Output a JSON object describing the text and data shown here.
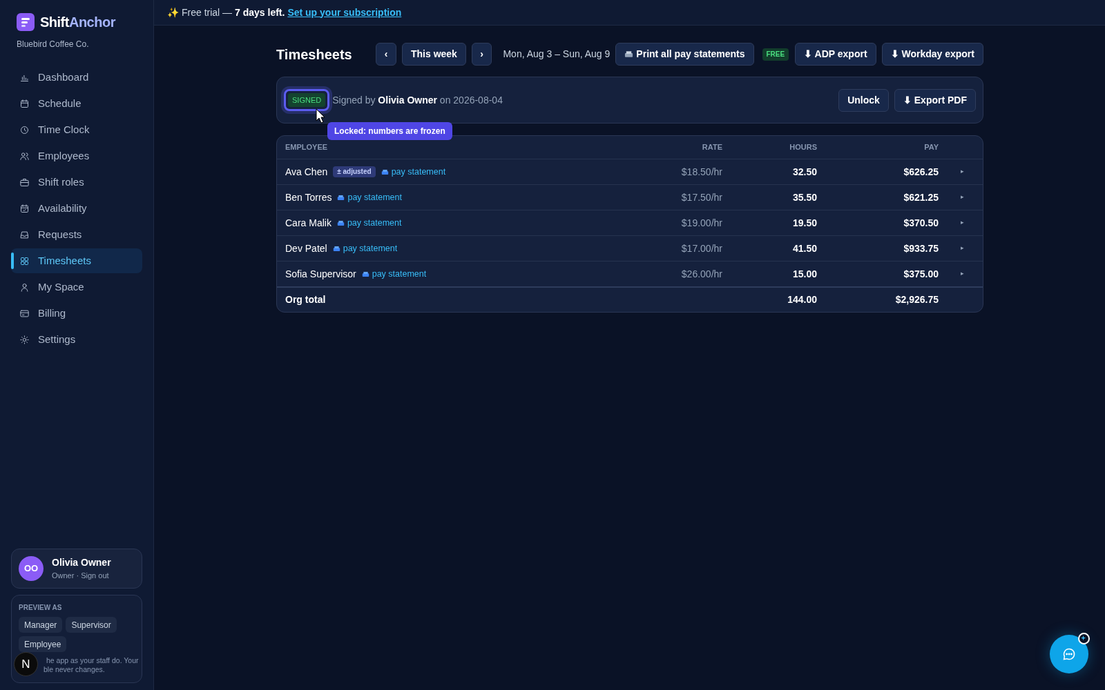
{
  "brand": {
    "name_part_1": "Shift",
    "name_part_2": "Anchor",
    "org": "Bluebird Coffee Co."
  },
  "nav": [
    {
      "label": "Dashboard",
      "selected": false
    },
    {
      "label": "Schedule",
      "selected": false
    },
    {
      "label": "Time Clock",
      "selected": false
    },
    {
      "label": "Employees",
      "selected": false
    },
    {
      "label": "Shift roles",
      "selected": false
    },
    {
      "label": "Availability",
      "selected": false
    },
    {
      "label": "Requests",
      "selected": false
    },
    {
      "label": "Timesheets",
      "selected": true
    },
    {
      "label": "My Space",
      "selected": false
    },
    {
      "label": "Billing",
      "selected": false
    },
    {
      "label": "Settings",
      "selected": false
    }
  ],
  "user": {
    "initials": "OO",
    "name": "Olivia Owner",
    "role": "Owner",
    "separator": "·",
    "sign_out": "Sign out"
  },
  "preview": {
    "title": "PREVIEW AS",
    "roles": [
      "Manager",
      "Supervisor",
      "Employee"
    ],
    "hint_lines": [
      "he app as your staff do. Your",
      "ble never changes."
    ]
  },
  "banner": {
    "icon": "✨",
    "text": "Free trial — ",
    "bold": "7 days left.",
    "link": "Set up your subscription"
  },
  "header": {
    "title": "Timesheets",
    "prev": "‹",
    "this_week": "This week",
    "next": "›",
    "range": "Mon, Aug 3 – Sun, Aug 9",
    "print": "Print all pay statements",
    "free_badge": "FREE",
    "adp": "⬇ ADP export",
    "workday": "⬇ Workday export"
  },
  "signed": {
    "badge": "SIGNED",
    "prefix": "Signed by",
    "name": "Olivia Owner",
    "suffix": "on 2026-08-04",
    "unlock": "Unlock",
    "export": "⬇ Export PDF",
    "tooltip": "Locked: numbers are frozen"
  },
  "table": {
    "columns": [
      "EMPLOYEE",
      "RATE",
      "HOURS",
      "PAY"
    ],
    "rows": [
      {
        "name": "Ava Chen",
        "adjusted": "± adjusted",
        "link": "pay statement",
        "rate": "$18.50/hr",
        "hours": "32.50",
        "pay": "$626.25",
        "expand": "▸"
      },
      {
        "name": "Ben Torres",
        "link": "pay statement",
        "rate": "$17.50/hr",
        "hours": "35.50",
        "pay": "$621.25",
        "expand": "▸"
      },
      {
        "name": "Cara Malik",
        "link": "pay statement",
        "rate": "$19.00/hr",
        "hours": "19.50",
        "pay": "$370.50",
        "expand": "▸"
      },
      {
        "name": "Dev Patel",
        "link": "pay statement",
        "rate": "$17.00/hr",
        "hours": "41.50",
        "pay": "$933.75",
        "expand": "▸"
      },
      {
        "name": "Sofia Supervisor",
        "link": "pay statement",
        "rate": "$26.00/hr",
        "hours": "15.00",
        "pay": "$375.00",
        "expand": "▸"
      }
    ],
    "total": {
      "label": "Org total",
      "hours": "144.00",
      "pay": "$2,926.75"
    }
  },
  "dev_badge": "N"
}
